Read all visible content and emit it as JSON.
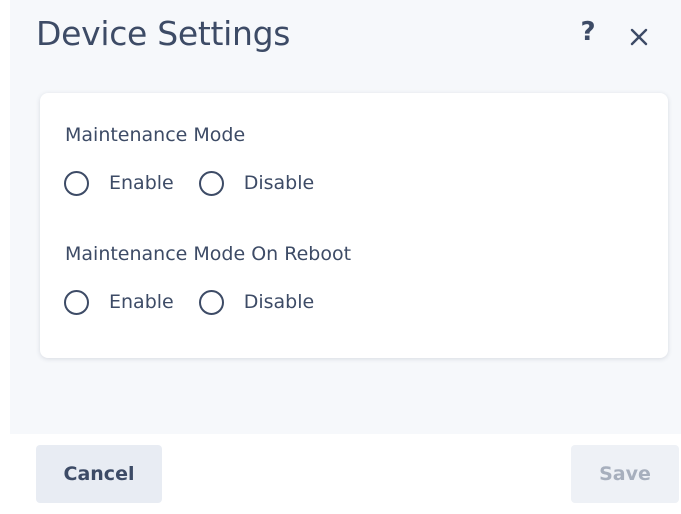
{
  "dialog": {
    "title": "Device Settings",
    "help_icon": "question-mark-icon",
    "close_icon": "close-icon"
  },
  "settings": [
    {
      "label": "Maintenance Mode",
      "options": [
        "Enable",
        "Disable"
      ],
      "selected": null
    },
    {
      "label": "Maintenance Mode On Reboot",
      "options": [
        "Enable",
        "Disable"
      ],
      "selected": null
    }
  ],
  "footer": {
    "cancel_label": "Cancel",
    "save_label": "Save",
    "save_disabled": true
  },
  "colors": {
    "text": "#3d4b66",
    "body_background": "#f6f8fb",
    "card_background": "#ffffff",
    "cancel_background": "#e8ecf3",
    "save_background": "#eef1f6",
    "save_text_disabled": "#a7afbd"
  }
}
